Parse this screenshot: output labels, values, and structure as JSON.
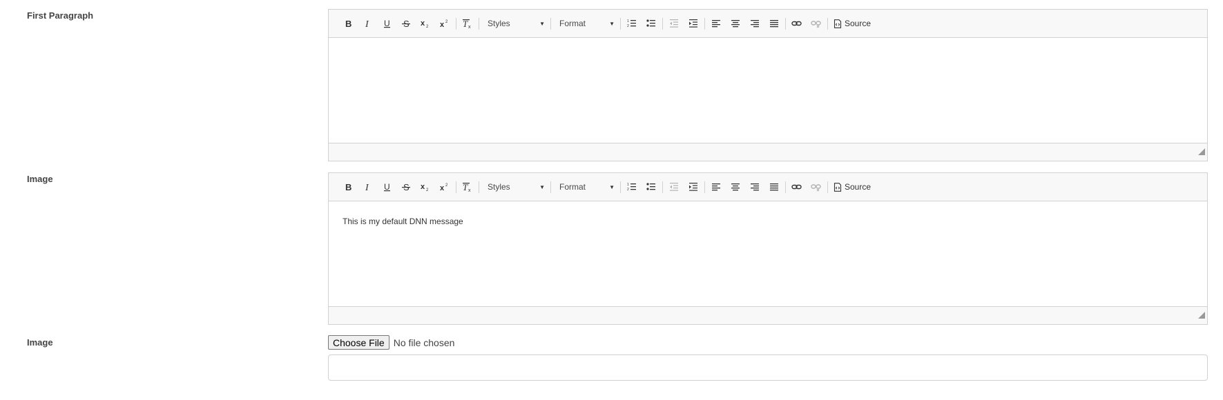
{
  "fields": {
    "first_paragraph_label": "First Paragraph",
    "image_editor_label": "Image",
    "image_upload_label": "Image"
  },
  "toolbar": {
    "bold_icon": "bold-icon",
    "italic_icon": "italic-icon",
    "underline_icon": "underline-icon",
    "strike_icon": "strikethrough-icon",
    "subscript_icon": "subscript-icon",
    "superscript_icon": "superscript-icon",
    "remove_format_icon": "remove-format-icon",
    "styles_label": "Styles",
    "format_label": "Format",
    "numbered_list_icon": "numbered-list-icon",
    "bulleted_list_icon": "bulleted-list-icon",
    "outdent_icon": "outdent-icon",
    "indent_icon": "indent-icon",
    "align_left_icon": "align-left-icon",
    "align_center_icon": "align-center-icon",
    "align_right_icon": "align-right-icon",
    "justify_icon": "justify-icon",
    "link_icon": "link-icon",
    "unlink_icon": "unlink-icon",
    "source_label": "Source"
  },
  "editors": {
    "first_paragraph_content": "",
    "image_content": "This is my default DNN message"
  },
  "upload": {
    "button_label": "Choose File",
    "status": "No file chosen"
  },
  "text_input": {
    "value": ""
  }
}
